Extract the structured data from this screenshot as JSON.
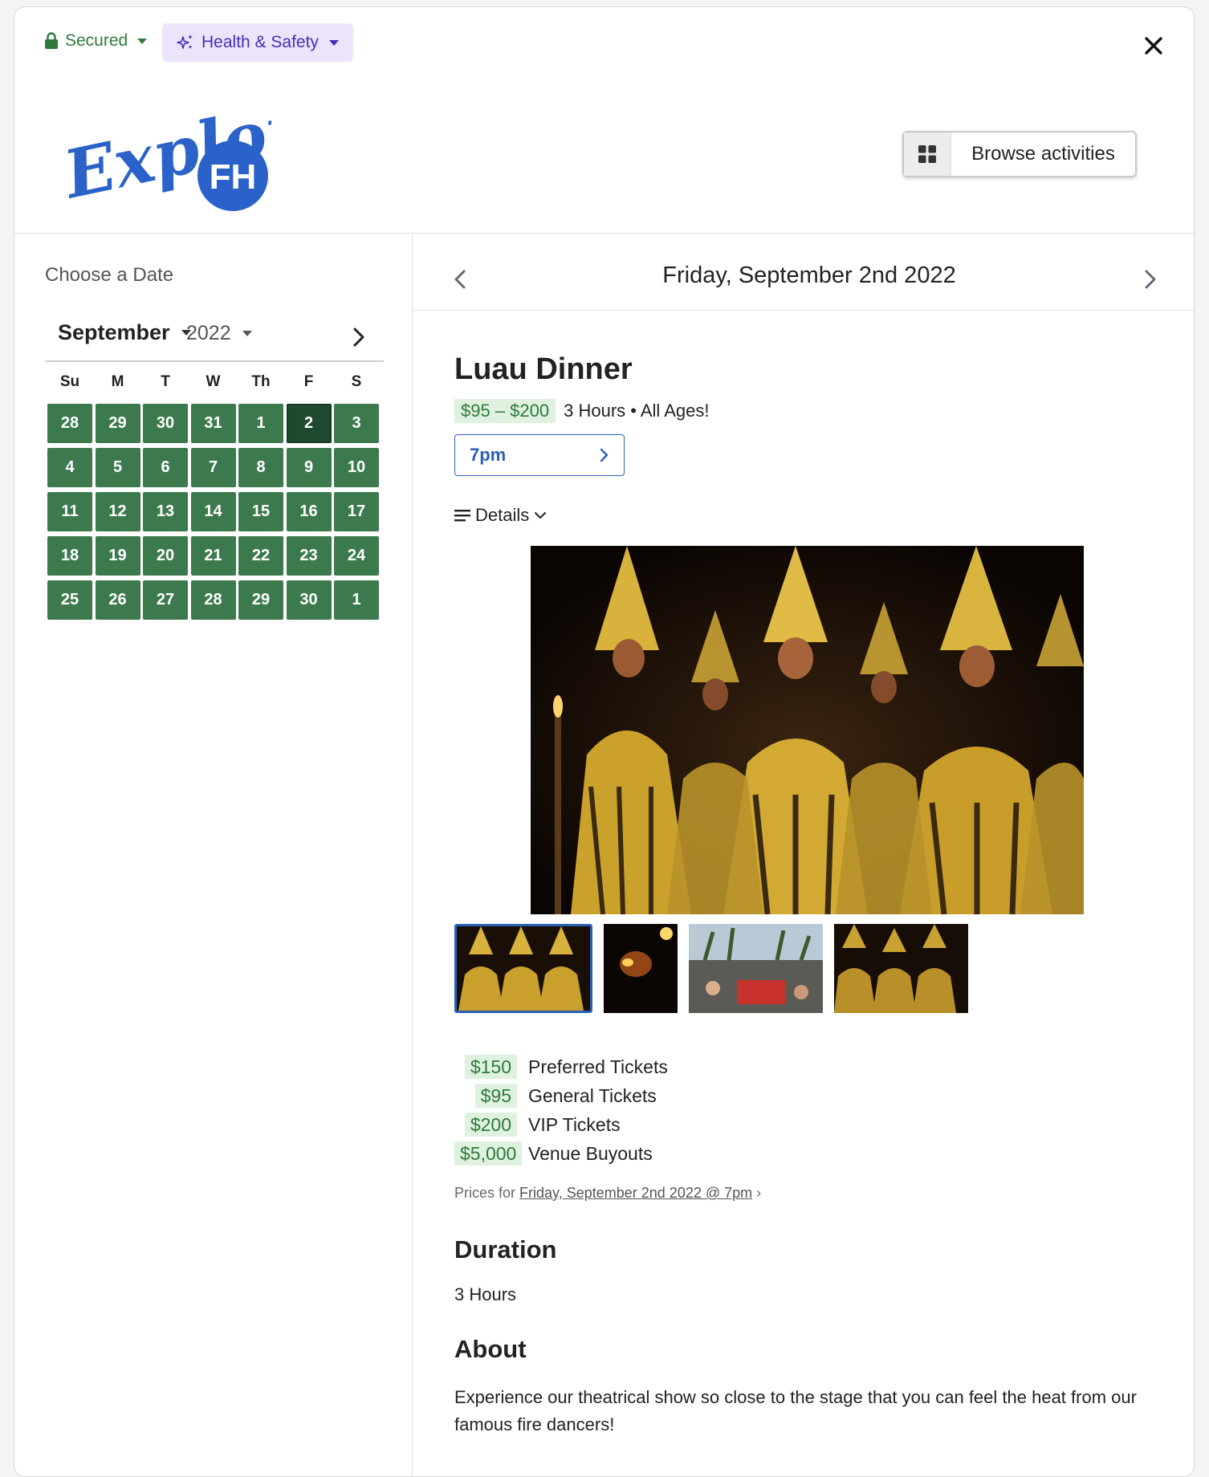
{
  "topbar": {
    "secured_label": "Secured",
    "health_label": "Health & Safety"
  },
  "header": {
    "logo_text": "Explore",
    "logo_badge": "FH",
    "browse_label": "Browse activities"
  },
  "calendar": {
    "heading": "Choose a Date",
    "month": "September",
    "year": "2022",
    "weekdays": [
      "Su",
      "M",
      "T",
      "W",
      "Th",
      "F",
      "S"
    ],
    "days": [
      "28",
      "29",
      "30",
      "31",
      "1",
      "2",
      "3",
      "4",
      "5",
      "6",
      "7",
      "8",
      "9",
      "10",
      "11",
      "12",
      "13",
      "14",
      "15",
      "16",
      "17",
      "18",
      "19",
      "20",
      "21",
      "22",
      "23",
      "24",
      "25",
      "26",
      "27",
      "28",
      "29",
      "30",
      "1"
    ],
    "selected_day": "2"
  },
  "date_nav": {
    "title": "Friday, September 2nd 2022"
  },
  "activity": {
    "title": "Luau Dinner",
    "price_range": "$95 – $200",
    "meta": "3 Hours • All Ages!",
    "time_label": "7pm",
    "details_label": "Details"
  },
  "prices": [
    {
      "amount": "$150",
      "label": "Preferred Tickets"
    },
    {
      "amount": "$95",
      "label": "General Tickets"
    },
    {
      "amount": "$200",
      "label": "VIP Tickets"
    },
    {
      "amount": "$5,000",
      "label": "Venue Buyouts"
    }
  ],
  "prices_for": {
    "prefix": "Prices for",
    "link": "Friday, September 2nd 2022 @ 7pm",
    "suffix": "›"
  },
  "duration": {
    "heading": "Duration",
    "value": "3 Hours"
  },
  "about": {
    "heading": "About",
    "text": "Experience our theatrical show so close to the stage that you can feel the heat from our famous fire dancers!"
  },
  "colors": {
    "calendar_green": "#3c7a4e",
    "calendar_selected": "#1f4a2e",
    "price_green": "#2f7a3c",
    "price_bg": "#dff2df",
    "brand_blue": "#2a5fb8",
    "health_purple": "#4b2bb8"
  }
}
